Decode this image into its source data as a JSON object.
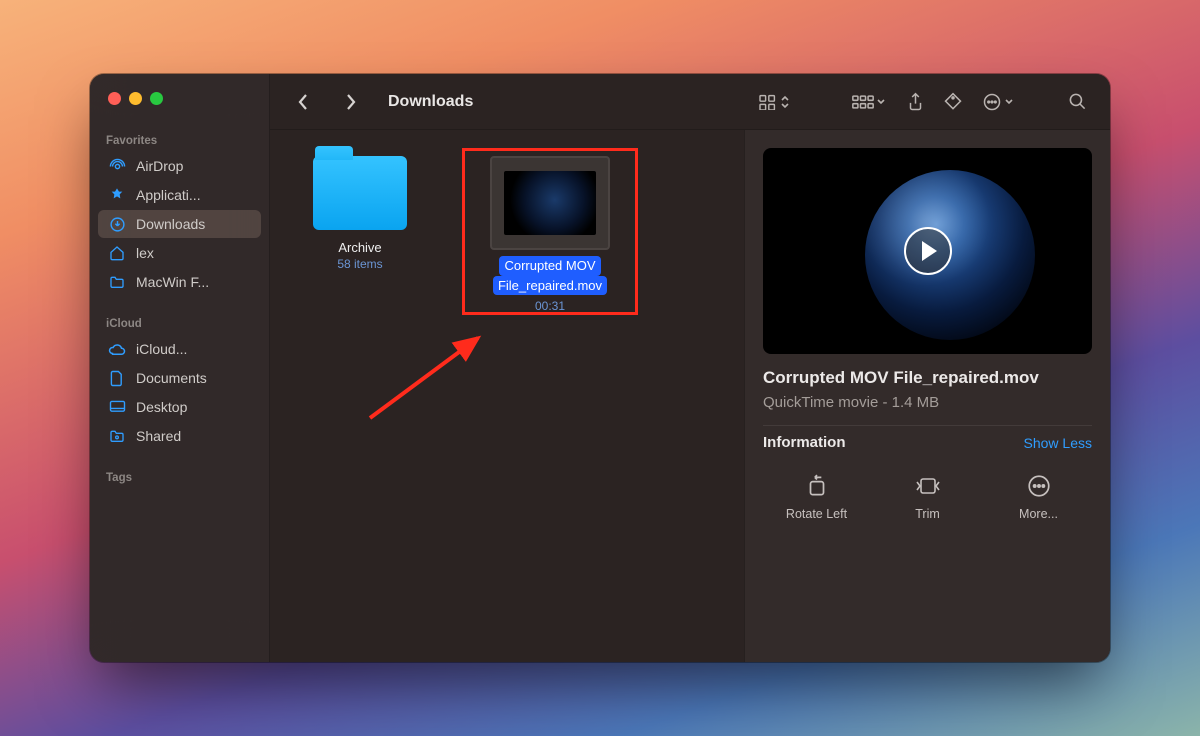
{
  "window_title": "Downloads",
  "sidebar": {
    "sections": {
      "favorites_label": "Favorites",
      "icloud_label": "iCloud",
      "tags_label": "Tags"
    },
    "favorites": [
      {
        "label": "AirDrop",
        "icon": "airdrop-icon"
      },
      {
        "label": "Applicati...",
        "icon": "apps-icon"
      },
      {
        "label": "Downloads",
        "icon": "downloads-icon",
        "selected": true
      },
      {
        "label": "lex",
        "icon": "home-icon"
      },
      {
        "label": "MacWin F...",
        "icon": "folder-icon"
      }
    ],
    "icloud": [
      {
        "label": "iCloud...",
        "icon": "cloud-icon"
      },
      {
        "label": "Documents",
        "icon": "document-icon"
      },
      {
        "label": "Desktop",
        "icon": "desktop-icon"
      },
      {
        "label": "Shared",
        "icon": "shared-folder-icon"
      }
    ]
  },
  "grid": {
    "folder": {
      "name": "Archive",
      "subtitle": "58 items"
    },
    "selected_file": {
      "name_line1": "Corrupted MOV",
      "name_line2": "File_repaired.mov",
      "duration": "00:31"
    }
  },
  "preview": {
    "title": "Corrupted MOV File_repaired.mov",
    "meta": "QuickTime movie - 1.4 MB",
    "info_label": "Information",
    "show_less": "Show Less",
    "actions": [
      {
        "label": "Rotate Left"
      },
      {
        "label": "Trim"
      },
      {
        "label": "More..."
      }
    ]
  }
}
